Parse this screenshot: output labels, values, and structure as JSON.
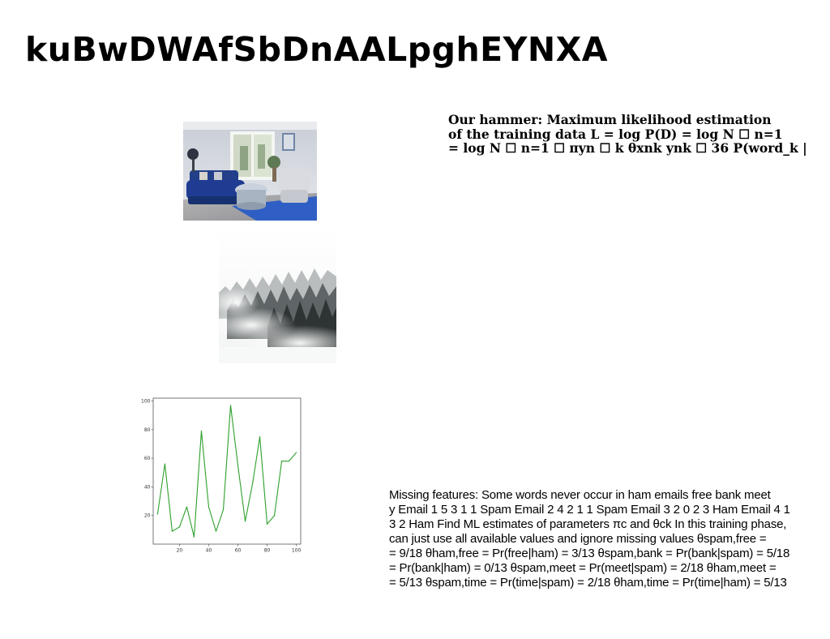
{
  "page": {
    "title": "kuBwDWAfSbDnAALpghEYNXA"
  },
  "images": {
    "living_room": {
      "name": "living-room-photo"
    },
    "foggy_forest": {
      "name": "foggy-forest-photo"
    }
  },
  "mle_text": {
    "lines": [
      "Our hammer: Maximum likelihood estimation",
      "of the training data L = log P(D) = log N ☐ n=1",
      "= log N ☐ n=1 ☐ πyn ☐ k θxnk ynk ☐ 36 P(word_k |"
    ]
  },
  "missing_text": {
    "lines": [
      "Missing features: Some words never occur in ham emails free bank meet",
      "y Email 1 5 3 1 1 Spam Email 2 4 2 1 1 Spam Email 3 2 0 2 3 Ham Email 4 1",
      "3 2 Ham Find ML estimates of parameters πc and θck In this training phase,",
      "can just use all available values and ignore missing values θspam,free =",
      "= 9/18 θham,free = Pr(free|ham) = 3/13 θspam,bank = Pr(bank|spam) = 5/18",
      "= Pr(bank|ham) = 0/13 θspam,meet = Pr(meet|spam) = 2/18 θham,meet =",
      "= 5/13 θspam,time = Pr(time|spam) = 2/18 θham,time = Pr(time|ham) = 5/13"
    ]
  },
  "chart_data": {
    "type": "line",
    "x": [
      5,
      10,
      15,
      20,
      25,
      30,
      35,
      40,
      45,
      50,
      55,
      60,
      65,
      70,
      75,
      80,
      85,
      90,
      95,
      100
    ],
    "series": [
      {
        "values": [
          21,
          56,
          9,
          12,
          26,
          5,
          79,
          26,
          9,
          24,
          97,
          55,
          16,
          42,
          75,
          14,
          20,
          58,
          58,
          64
        ],
        "color": "#2ca02c"
      }
    ],
    "xticks": [
      20,
      40,
      60,
      80,
      100
    ],
    "yticks": [
      20,
      40,
      60,
      80,
      100
    ],
    "xlim": [
      2,
      103
    ],
    "ylim": [
      0,
      102
    ],
    "grid": false,
    "title": "",
    "xlabel": "",
    "ylabel": ""
  }
}
